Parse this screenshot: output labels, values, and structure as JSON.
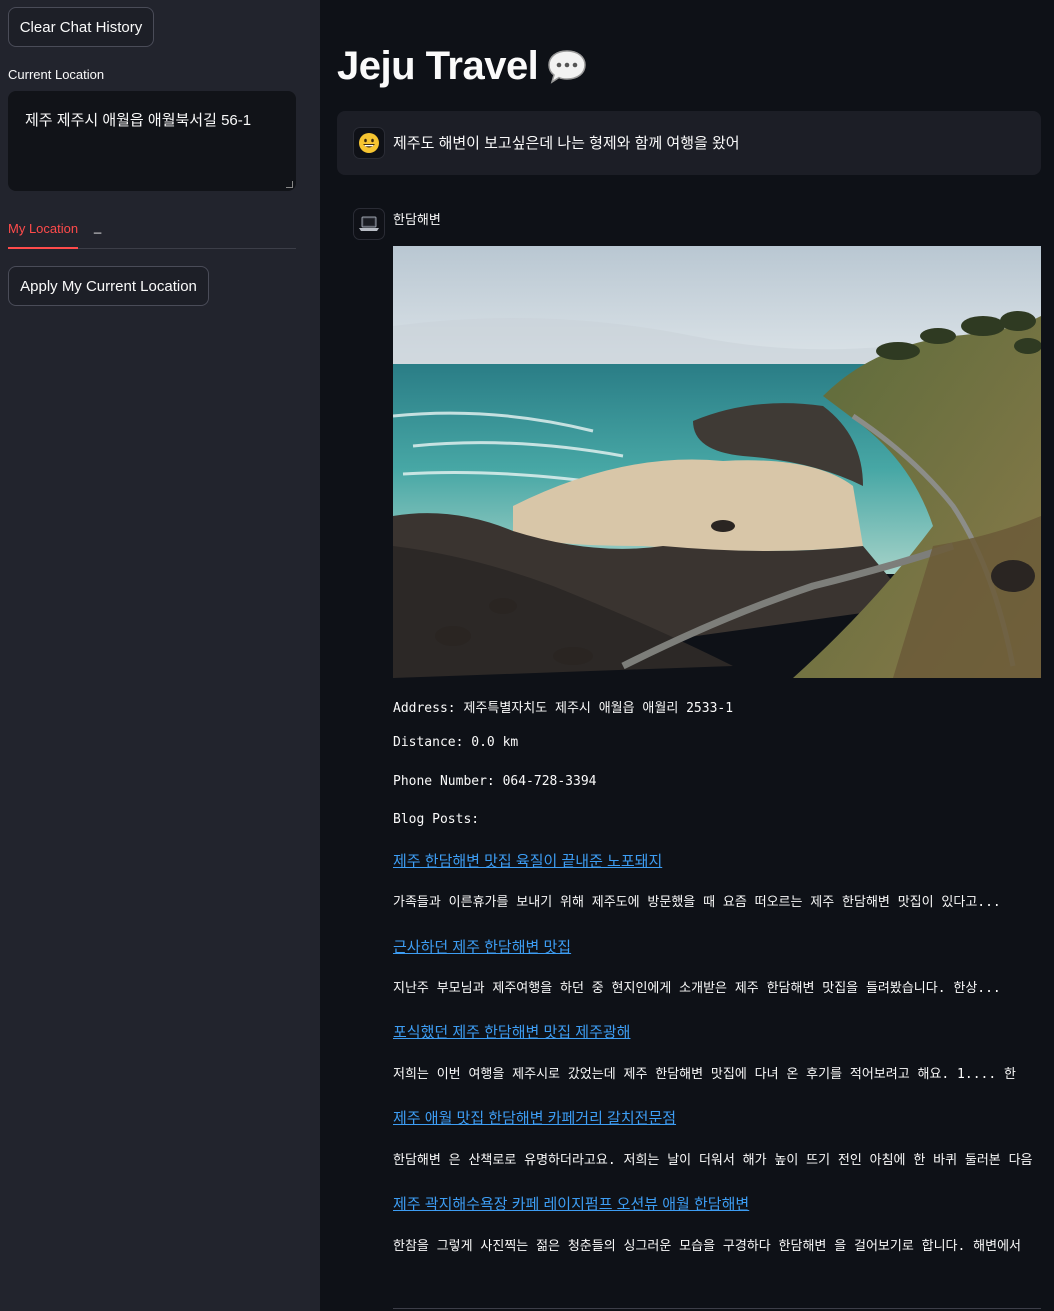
{
  "sidebar": {
    "clear_button": "Clear Chat History",
    "location_label": "Current Location",
    "location_value": "제주 제주시 애월읍 애월북서길 56-1",
    "tabs": [
      "My Location",
      "_"
    ],
    "apply_button": "Apply My Current Location"
  },
  "main": {
    "title": "Jeju Travel",
    "title_icon": "speech-bubble-icon",
    "user_message": "제주도 해변이 보고싶은데 나는 형제와 함께 여행을 왔어",
    "user_avatar_icon": "smiley-face-icon",
    "bot_avatar_icon": "laptop-icon",
    "bot_title": "한담해변",
    "address_line": "Address: 제주특별자치도 제주시 애월읍 애월리 2533-1",
    "distance_line": "Distance: 0.0 km",
    "phone_line": "Phone Number: 064-728-3394",
    "blog_label": "Blog Posts:",
    "blog_posts": [
      {
        "title": "제주 한담해변 맛집 육질이 끝내준 노포돼지",
        "snippet": "가족들과 이른휴가를 보내기 위해 제주도에 방문했을 때 요즘 떠오르는 제주  한담해변  맛집이 있다고..."
      },
      {
        "title": "근사하던 제주 한담해변 맛집",
        "snippet": "지난주 부모님과 제주여행을 하던 중 현지인에게 소개받은 제주  한담해변  맛집을 들려봤습니다. 한상..."
      },
      {
        "title": "포식했던 제주 한담해변 맛집 제주광해",
        "snippet": "저희는 이번 여행을 제주시로 갔었는데 제주  한담해변  맛집에 다녀 온 후기를 적어보려고 해요. 1.... 한"
      },
      {
        "title": "제주 애월 맛집 한담해변 카페거리 갈치전문점",
        "snippet": "한담해변 은 산책로로 유명하더라고요. 저희는 날이 더워서 해가 높이 뜨기 전인 아침에 한 바퀴 둘러본 다음"
      },
      {
        "title": "제주 곽지해수욕장 카페 레이지펌프 오션뷰 애월 한담해변",
        "snippet": "한참을 그렇게 사진찍는 젊은 청춘들의 싱그러운 모습을 구경하다  한담해변 을 걸어보기로 합니다. 해변에서"
      }
    ]
  }
}
